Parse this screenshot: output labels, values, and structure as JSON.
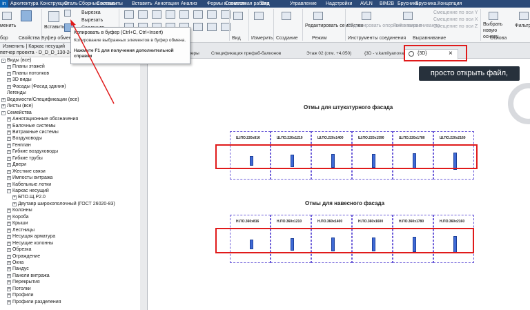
{
  "menubar": {
    "file": "in",
    "items": [
      "Архитектура",
      "Конструкция",
      "Сталь",
      "Сборные элементы",
      "Системы",
      "Вставить",
      "Аннотации",
      "Анализ",
      "Формы и генплан",
      "Совместная работа",
      "Вид",
      "Управление",
      "Надстройки",
      "AVLN",
      "BIM2B",
      "Брусника",
      "Брусника.Концепция"
    ]
  },
  "ribbon": {
    "modify_label": "менить",
    "properties_btn": "Свойства",
    "clipboard_label": "бор",
    "insert_label": "Вставить",
    "cut_label": "Вырезка",
    "clip_cut": "Вырезать",
    "connect_label": "Соединить",
    "clipboard_group": "Буфер обмена",
    "create_group": "Создание",
    "view_group": "Вид",
    "measure_group": "Измерить",
    "regime_group": "Режим",
    "work_tools_group": "Инструменты соединения",
    "alignment_group": "Выравнивание",
    "base_group": "Основа",
    "filter_label": "Фильтр",
    "edit_family": "Редактировать семейство",
    "edit_support": "Редактировать опорный элемент",
    "alignment_points": "Точки выравнивания",
    "offset_x": "Смещение по оси Y",
    "offset_y": "Смещение по оси X",
    "offset_z": "Смещение по оси Z",
    "select_new_base": "Выбрать новую основу",
    "filter_btn": "Фильтр"
  },
  "tooltip": {
    "title": "Копировать в буфер (Ctrl+C, Ctrl+Insert)",
    "desc": "Копирование выбранных элементов в буфер обмена.",
    "help": "Нажмите F1 для получения дополнительной справки"
  },
  "optbar": {
    "text": "Изменить | Каркас несущий"
  },
  "browser": {
    "title": "петчер проекта - D_D_D_130-240.B...",
    "items": [
      {
        "label": "Виды (все)",
        "expand": "-",
        "indent": 0
      },
      {
        "label": "Планы этажей",
        "expand": "+",
        "indent": 1
      },
      {
        "label": "Планы потолков",
        "expand": "+",
        "indent": 1
      },
      {
        "label": "3D виды",
        "expand": "+",
        "indent": 1
      },
      {
        "label": "Фасады (Фасад здания)",
        "expand": "+",
        "indent": 1
      },
      {
        "label": "Легенды",
        "expand": "",
        "indent": 0
      },
      {
        "label": "Ведомости/Спецификации (все)",
        "expand": "+",
        "indent": 0
      },
      {
        "label": "Листы (все)",
        "expand": "+",
        "indent": 0
      },
      {
        "label": "Семейства",
        "expand": "-",
        "indent": 0
      },
      {
        "label": "Аннотационные обозначения",
        "expand": "+",
        "indent": 1
      },
      {
        "label": "Балочные системы",
        "expand": "+",
        "indent": 1
      },
      {
        "label": "Витражные системы",
        "expand": "+",
        "indent": 1
      },
      {
        "label": "Воздуховоды",
        "expand": "+",
        "indent": 1
      },
      {
        "label": "Генплан",
        "expand": "+",
        "indent": 1
      },
      {
        "label": "Гибкие воздуховоды",
        "expand": "+",
        "indent": 1
      },
      {
        "label": "Гибкие трубы",
        "expand": "+",
        "indent": 1
      },
      {
        "label": "Двери",
        "expand": "+",
        "indent": 1
      },
      {
        "label": "Жесткие связи",
        "expand": "+",
        "indent": 1
      },
      {
        "label": "Импосты витража",
        "expand": "+",
        "indent": 1
      },
      {
        "label": "Кабельные лотки",
        "expand": "+",
        "indent": 1
      },
      {
        "label": "Каркас несущий",
        "expand": "-",
        "indent": 1
      },
      {
        "label": "БПО.Щ.Р2.0",
        "expand": "+",
        "indent": 2
      },
      {
        "label": "Двутавр широкополочный (ГОСТ 26020-83)",
        "expand": "+",
        "indent": 2
      },
      {
        "label": "Колонны",
        "expand": "+",
        "indent": 1
      },
      {
        "label": "Короба",
        "expand": "+",
        "indent": 1
      },
      {
        "label": "Крыши",
        "expand": "+",
        "indent": 1
      },
      {
        "label": "Лестницы",
        "expand": "+",
        "indent": 1
      },
      {
        "label": "Несущая арматура",
        "expand": "+",
        "indent": 1
      },
      {
        "label": "Несущие колонны",
        "expand": "+",
        "indent": 1
      },
      {
        "label": "Обрезка",
        "expand": "+",
        "indent": 1
      },
      {
        "label": "Ограждение",
        "expand": "+",
        "indent": 1
      },
      {
        "label": "Окна",
        "expand": "+",
        "indent": 1
      },
      {
        "label": "Пандус",
        "expand": "+",
        "indent": 1
      },
      {
        "label": "Панели витража",
        "expand": "+",
        "indent": 1
      },
      {
        "label": "Перекрытия",
        "expand": "+",
        "indent": 1
      },
      {
        "label": "Потолки",
        "expand": "+",
        "indent": 1
      },
      {
        "label": "Профили",
        "expand": "+",
        "indent": 1
      },
      {
        "label": "Профили разделения",
        "expand": "+",
        "indent": 1
      }
    ]
  },
  "tabs": [
    {
      "label": "ммеры"
    },
    {
      "label": "Спецификация префаб-балконов"
    },
    {
      "label": "Этаж 02 (отм. +4,050)"
    },
    {
      "label": "{3D - v.kamilyanova}"
    }
  ],
  "active_tab": {
    "label": "{3D}",
    "close": "×"
  },
  "hint": "просто открыть файл,",
  "drawing": {
    "schedule1": {
      "title": "Отмы для штукатурного фасада",
      "cells": [
        "Ш.ПО.220х816",
        "Ш.ПО.220х1210",
        "Ш.ПО.220х1400",
        "Ш.ПО.220х1590",
        "Ш.ПО.220х1780",
        "Ш.ПО.220х2160"
      ],
      "heights": [
        816,
        1210,
        1400,
        1590,
        1780,
        2160
      ]
    },
    "schedule2": {
      "title": "Отмы для навесного фасада",
      "cells": [
        "Н.ПО.360х816",
        "Н.ПО.360х1210",
        "Н.ПО.360х1400",
        "Н.ПО.360х1600",
        "Н.ПО.360х1780",
        "Н.ПО.360х2160"
      ],
      "heights": [
        816,
        1210,
        1400,
        1600,
        1780,
        2160
      ]
    }
  },
  "colors": {
    "highlight_red": "#e01a1a",
    "dashed": "#6a5ad8",
    "bar_fill": "#3f6ad6",
    "menubar": "#2b4a78"
  }
}
